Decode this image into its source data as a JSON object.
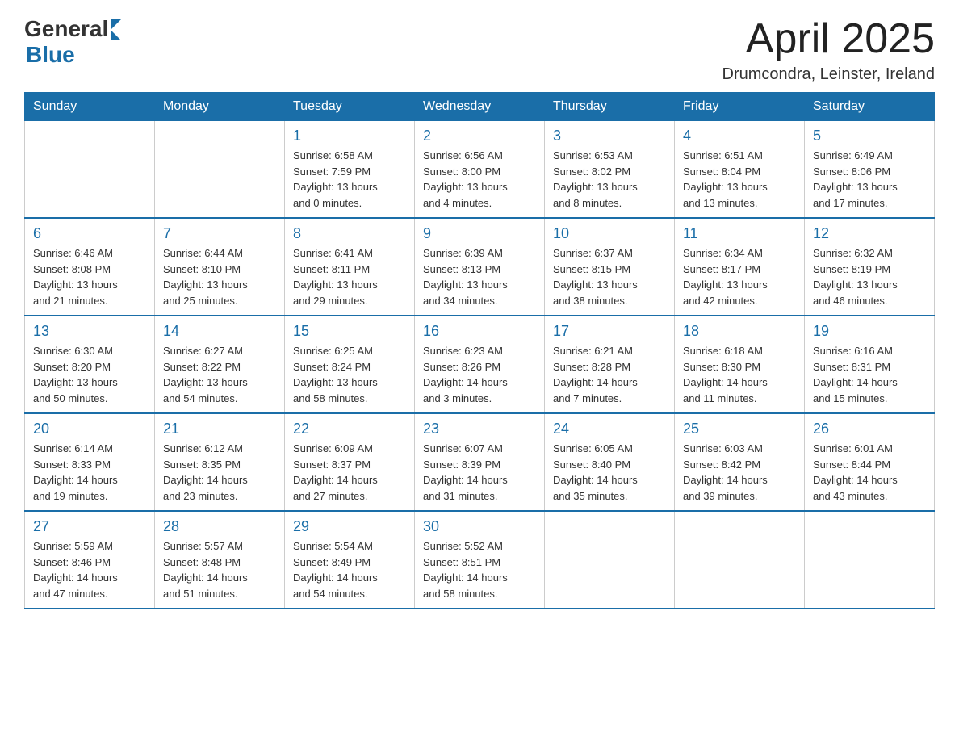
{
  "logo": {
    "general": "General",
    "blue": "Blue"
  },
  "title": "April 2025",
  "location": "Drumcondra, Leinster, Ireland",
  "headers": [
    "Sunday",
    "Monday",
    "Tuesday",
    "Wednesday",
    "Thursday",
    "Friday",
    "Saturday"
  ],
  "weeks": [
    [
      {
        "day": "",
        "info": ""
      },
      {
        "day": "",
        "info": ""
      },
      {
        "day": "1",
        "info": "Sunrise: 6:58 AM\nSunset: 7:59 PM\nDaylight: 13 hours\nand 0 minutes."
      },
      {
        "day": "2",
        "info": "Sunrise: 6:56 AM\nSunset: 8:00 PM\nDaylight: 13 hours\nand 4 minutes."
      },
      {
        "day": "3",
        "info": "Sunrise: 6:53 AM\nSunset: 8:02 PM\nDaylight: 13 hours\nand 8 minutes."
      },
      {
        "day": "4",
        "info": "Sunrise: 6:51 AM\nSunset: 8:04 PM\nDaylight: 13 hours\nand 13 minutes."
      },
      {
        "day": "5",
        "info": "Sunrise: 6:49 AM\nSunset: 8:06 PM\nDaylight: 13 hours\nand 17 minutes."
      }
    ],
    [
      {
        "day": "6",
        "info": "Sunrise: 6:46 AM\nSunset: 8:08 PM\nDaylight: 13 hours\nand 21 minutes."
      },
      {
        "day": "7",
        "info": "Sunrise: 6:44 AM\nSunset: 8:10 PM\nDaylight: 13 hours\nand 25 minutes."
      },
      {
        "day": "8",
        "info": "Sunrise: 6:41 AM\nSunset: 8:11 PM\nDaylight: 13 hours\nand 29 minutes."
      },
      {
        "day": "9",
        "info": "Sunrise: 6:39 AM\nSunset: 8:13 PM\nDaylight: 13 hours\nand 34 minutes."
      },
      {
        "day": "10",
        "info": "Sunrise: 6:37 AM\nSunset: 8:15 PM\nDaylight: 13 hours\nand 38 minutes."
      },
      {
        "day": "11",
        "info": "Sunrise: 6:34 AM\nSunset: 8:17 PM\nDaylight: 13 hours\nand 42 minutes."
      },
      {
        "day": "12",
        "info": "Sunrise: 6:32 AM\nSunset: 8:19 PM\nDaylight: 13 hours\nand 46 minutes."
      }
    ],
    [
      {
        "day": "13",
        "info": "Sunrise: 6:30 AM\nSunset: 8:20 PM\nDaylight: 13 hours\nand 50 minutes."
      },
      {
        "day": "14",
        "info": "Sunrise: 6:27 AM\nSunset: 8:22 PM\nDaylight: 13 hours\nand 54 minutes."
      },
      {
        "day": "15",
        "info": "Sunrise: 6:25 AM\nSunset: 8:24 PM\nDaylight: 13 hours\nand 58 minutes."
      },
      {
        "day": "16",
        "info": "Sunrise: 6:23 AM\nSunset: 8:26 PM\nDaylight: 14 hours\nand 3 minutes."
      },
      {
        "day": "17",
        "info": "Sunrise: 6:21 AM\nSunset: 8:28 PM\nDaylight: 14 hours\nand 7 minutes."
      },
      {
        "day": "18",
        "info": "Sunrise: 6:18 AM\nSunset: 8:30 PM\nDaylight: 14 hours\nand 11 minutes."
      },
      {
        "day": "19",
        "info": "Sunrise: 6:16 AM\nSunset: 8:31 PM\nDaylight: 14 hours\nand 15 minutes."
      }
    ],
    [
      {
        "day": "20",
        "info": "Sunrise: 6:14 AM\nSunset: 8:33 PM\nDaylight: 14 hours\nand 19 minutes."
      },
      {
        "day": "21",
        "info": "Sunrise: 6:12 AM\nSunset: 8:35 PM\nDaylight: 14 hours\nand 23 minutes."
      },
      {
        "day": "22",
        "info": "Sunrise: 6:09 AM\nSunset: 8:37 PM\nDaylight: 14 hours\nand 27 minutes."
      },
      {
        "day": "23",
        "info": "Sunrise: 6:07 AM\nSunset: 8:39 PM\nDaylight: 14 hours\nand 31 minutes."
      },
      {
        "day": "24",
        "info": "Sunrise: 6:05 AM\nSunset: 8:40 PM\nDaylight: 14 hours\nand 35 minutes."
      },
      {
        "day": "25",
        "info": "Sunrise: 6:03 AM\nSunset: 8:42 PM\nDaylight: 14 hours\nand 39 minutes."
      },
      {
        "day": "26",
        "info": "Sunrise: 6:01 AM\nSunset: 8:44 PM\nDaylight: 14 hours\nand 43 minutes."
      }
    ],
    [
      {
        "day": "27",
        "info": "Sunrise: 5:59 AM\nSunset: 8:46 PM\nDaylight: 14 hours\nand 47 minutes."
      },
      {
        "day": "28",
        "info": "Sunrise: 5:57 AM\nSunset: 8:48 PM\nDaylight: 14 hours\nand 51 minutes."
      },
      {
        "day": "29",
        "info": "Sunrise: 5:54 AM\nSunset: 8:49 PM\nDaylight: 14 hours\nand 54 minutes."
      },
      {
        "day": "30",
        "info": "Sunrise: 5:52 AM\nSunset: 8:51 PM\nDaylight: 14 hours\nand 58 minutes."
      },
      {
        "day": "",
        "info": ""
      },
      {
        "day": "",
        "info": ""
      },
      {
        "day": "",
        "info": ""
      }
    ]
  ]
}
